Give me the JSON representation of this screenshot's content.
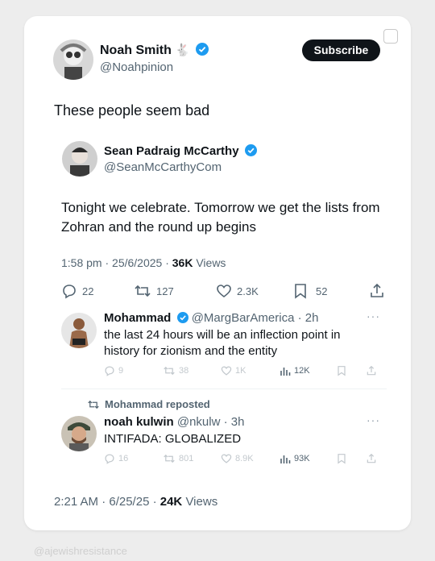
{
  "main_post": {
    "author_name": "Noah Smith",
    "author_emoji": "🐇",
    "author_handle": "@Noahpinion",
    "subscribe_label": "Subscribe",
    "text": "These people seem bad",
    "footer_time": "2:21 AM · 6/25/25 · ",
    "footer_views_count": "24K",
    "footer_views_label": " Views"
  },
  "quoted_post": {
    "author_name": "Sean Padraig McCarthy",
    "author_handle": "@SeanMcCarthyCom",
    "text": "Tonight we celebrate. Tomorrow we get the lists from Zohran and the round up begins",
    "meta_time": "1:58 pm · 25/6/2025 · ",
    "views_count": "36K",
    "views_label": " Views",
    "replies": "22",
    "reposts": "127",
    "likes": "2.3K",
    "bookmarks": "52"
  },
  "reply_1": {
    "author_name": "Mohammad",
    "author_handle": "@MargBarAmerica · 2h",
    "text": "the last 24 hours will be an inflection point in history for zionism and the entity",
    "replies": "9",
    "reposts": "38",
    "likes": "1K",
    "views": "12K"
  },
  "reply_2": {
    "repost_label": "Mohammad reposted",
    "author_name": "noah kulwin",
    "author_handle": "@nkulw · 3h",
    "text": "INTIFADA: GLOBALIZED",
    "replies": "16",
    "reposts": "801",
    "likes": "8.9K",
    "views": "93K"
  },
  "watermark": "@ajewishresistance",
  "colors": {
    "verified": "#1d9bf0",
    "text": "#0f1419",
    "muted": "#536471"
  }
}
